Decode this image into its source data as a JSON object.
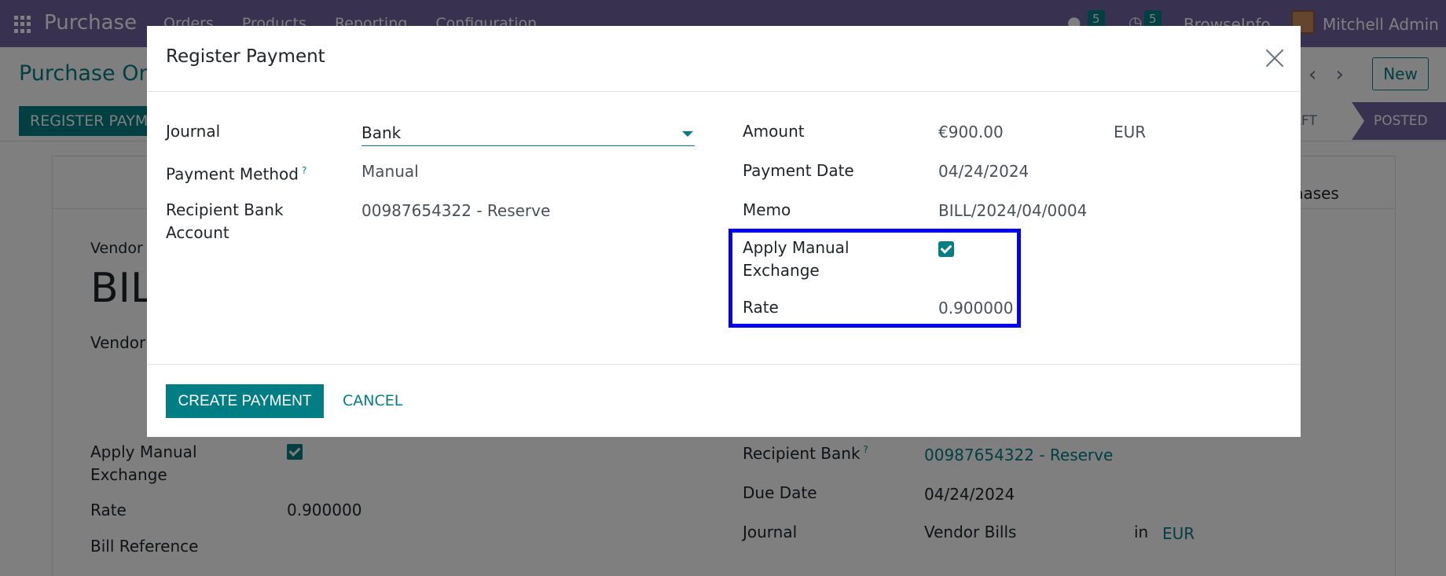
{
  "topbar": {
    "app_name": "Purchase",
    "menu": [
      "Orders",
      "Products",
      "Reporting",
      "Configuration"
    ],
    "messages_count": "5",
    "activities_count": "5",
    "company": "BrowseInfo",
    "user": "Mitchell Admin"
  },
  "control": {
    "breadcrumb": "Purchase Or",
    "new_label": "New",
    "register_label": "REGISTER PAYMENT",
    "status_draft": "DRAFT",
    "status_posted": "POSTED"
  },
  "background": {
    "purchases_tab": "rchases",
    "vendor_label": "Vendor",
    "bill_title": "BIL",
    "vendor_label2": "Vendor",
    "apply_manual_exchange": "Apply Manual\nExchange",
    "rate_label": "Rate",
    "rate_value": "0.900000",
    "bill_reference": "Bill Reference",
    "recipient_bank_label": "Recipient Bank",
    "recipient_bank_value": "00987654322 - Reserve",
    "due_date_label": "Due Date",
    "due_date_value": "04/24/2024",
    "journal_label": "Journal",
    "journal_value": "Vendor Bills",
    "in_label": "in",
    "currency": "EUR"
  },
  "modal": {
    "title": "Register Payment",
    "journal_label": "Journal",
    "journal_value": "Bank",
    "payment_method_label": "Payment Method",
    "help_mark": "?",
    "payment_method_value": "Manual",
    "recipient_bank_label": "Recipient Bank\nAccount",
    "recipient_bank_value": "00987654322 - Reserve",
    "amount_label": "Amount",
    "amount_value": "€900.00",
    "currency": "EUR",
    "payment_date_label": "Payment Date",
    "payment_date_value": "04/24/2024",
    "memo_label": "Memo",
    "memo_value": "BILL/2024/04/0004",
    "apply_manual_exchange_label": "Apply Manual\nExchange",
    "apply_manual_exchange_checked": true,
    "rate_label": "Rate",
    "rate_value": "0.900000",
    "create_label": "CREATE PAYMENT",
    "cancel_label": "CANCEL"
  },
  "colors": {
    "brand": "#71639e",
    "accent": "#017e84",
    "highlight": "#0000f5"
  }
}
